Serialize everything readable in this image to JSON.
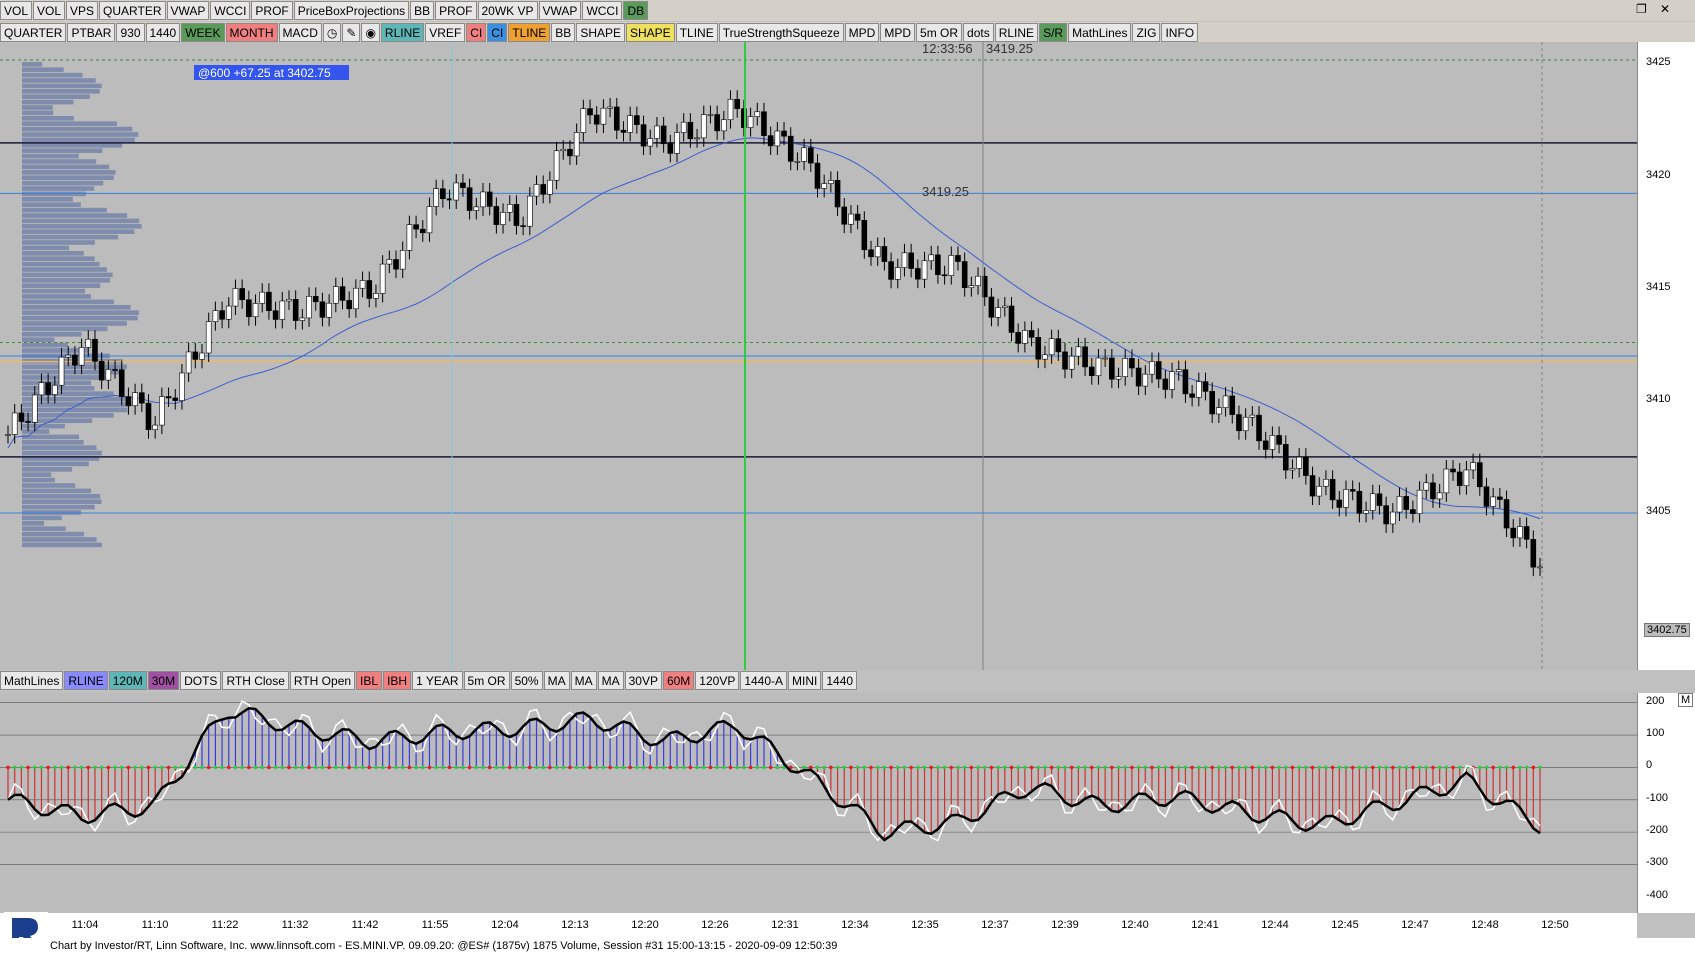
{
  "toolbar_top": [
    {
      "label": "VOL",
      "bg": "#e8e8e8"
    },
    {
      "label": "VOL",
      "bg": "#e8e8e8"
    },
    {
      "label": "VPS",
      "bg": "#e8e8e8"
    },
    {
      "label": "QUARTER",
      "bg": "#e8e8e8"
    },
    {
      "label": "VWAP",
      "bg": "#e8e8e8"
    },
    {
      "label": "WCCI",
      "bg": "#e8e8e8"
    },
    {
      "label": "PROF",
      "bg": "#e8e8e8"
    },
    {
      "label": "PriceBoxProjections",
      "bg": "#e8e8e8"
    },
    {
      "label": "BB",
      "bg": "#e8e8e8"
    },
    {
      "label": "PROF",
      "bg": "#e8e8e8"
    },
    {
      "label": "20WK VP",
      "bg": "#e8e8e8"
    },
    {
      "label": "VWAP",
      "bg": "#e8e8e8"
    },
    {
      "label": "WCCI",
      "bg": "#e8e8e8"
    },
    {
      "label": "DB",
      "bg": "#5a9a5a"
    }
  ],
  "toolbar_second": [
    {
      "label": "QUARTER",
      "bg": "#e8e8e8"
    },
    {
      "label": "PTBAR",
      "bg": "#e8e8e8"
    },
    {
      "label": "930",
      "bg": "#e8e8e8"
    },
    {
      "label": "1440",
      "bg": "#e8e8e8"
    },
    {
      "label": "WEEK",
      "bg": "#5a9a5a"
    },
    {
      "label": "MONTH",
      "bg": "#f08080"
    },
    {
      "label": "MACD",
      "bg": "#e8e8e8"
    },
    {
      "label": "",
      "icon": "clock-icon",
      "bg": "#e8e8e8"
    },
    {
      "label": "",
      "icon": "pencil-icon",
      "bg": "#e8e8e8"
    },
    {
      "label": "",
      "icon": "drop-icon",
      "bg": "#e8e8e8"
    },
    {
      "label": "RLINE",
      "bg": "#5fb6b6"
    },
    {
      "label": "VREF",
      "bg": "#e8e8e8"
    },
    {
      "label": "CI",
      "bg": "#f08080"
    },
    {
      "label": "CI",
      "bg": "#3a8fe0"
    },
    {
      "label": "TLINE",
      "bg": "#f0a030"
    },
    {
      "label": "BB",
      "bg": "#e8e8e8"
    },
    {
      "label": "SHAPE",
      "bg": "#e8e8e8"
    },
    {
      "label": "SHAPE",
      "bg": "#f0e060"
    },
    {
      "label": "TLINE",
      "bg": "#e8e8e8"
    },
    {
      "label": "TrueStrengthSqueeze",
      "bg": "#e8e8e8"
    },
    {
      "label": "MPD",
      "bg": "#e8e8e8"
    },
    {
      "label": "MPD",
      "bg": "#e8e8e8"
    },
    {
      "label": "5m OR",
      "bg": "#e8e8e8"
    },
    {
      "label": "dots",
      "bg": "#e8e8e8"
    },
    {
      "label": "RLINE",
      "bg": "#e8e8e8"
    },
    {
      "label": "S/R",
      "bg": "#5a9a5a"
    },
    {
      "label": "MathLines",
      "bg": "#e8e8e8"
    },
    {
      "label": "ZIG",
      "bg": "#e8e8e8"
    },
    {
      "label": "INFO",
      "bg": "#e8e8e8"
    }
  ],
  "toolbar_bottom": [
    {
      "label": "MathLines",
      "bg": "#e8e8e8"
    },
    {
      "label": "RLINE",
      "bg": "#8a8aff"
    },
    {
      "label": "120M",
      "bg": "#5fb6b6"
    },
    {
      "label": "30M",
      "bg": "#a050a0"
    },
    {
      "label": "DOTS",
      "bg": "#e8e8e8"
    },
    {
      "label": "RTH Close",
      "bg": "#e8e8e8"
    },
    {
      "label": "RTH Open",
      "bg": "#e8e8e8"
    },
    {
      "label": "IBL",
      "bg": "#f08080"
    },
    {
      "label": "IBH",
      "bg": "#f08080"
    },
    {
      "label": "1 YEAR",
      "bg": "#e8e8e8"
    },
    {
      "label": "5m OR",
      "bg": "#e8e8e8"
    },
    {
      "label": "50%",
      "bg": "#e8e8e8"
    },
    {
      "label": "MA",
      "bg": "#e8e8e8"
    },
    {
      "label": "MA",
      "bg": "#e8e8e8"
    },
    {
      "label": "MA",
      "bg": "#e8e8e8"
    },
    {
      "label": "30VP",
      "bg": "#e8e8e8"
    },
    {
      "label": "60M",
      "bg": "#f08080"
    },
    {
      "label": "120VP",
      "bg": "#e8e8e8"
    },
    {
      "label": "1440-A",
      "bg": "#e8e8e8"
    },
    {
      "label": "MINI",
      "bg": "#e8e8e8"
    },
    {
      "label": "1440",
      "bg": "#e8e8e8"
    }
  ],
  "annotations": {
    "bar_info": "@600  +67.25 at 3402.75",
    "cursor_time": "12:33:56",
    "cursor_price": "3419.25",
    "level_label": "3419.25",
    "last_price": "3402.75"
  },
  "price_axis": [
    "3425",
    "3420",
    "3415",
    "3410",
    "3405"
  ],
  "indicator_axis": [
    "200",
    "100",
    "0",
    "-100",
    "-200",
    "-300",
    "-400"
  ],
  "time_axis": [
    "11:04",
    "11:10",
    "11:22",
    "11:32",
    "11:42",
    "11:55",
    "12:04",
    "12:13",
    "12:20",
    "12:26",
    "12:31",
    "12:34",
    "12:35",
    "12:37",
    "12:39",
    "12:40",
    "12:41",
    "12:44",
    "12:45",
    "12:47",
    "12:48",
    "12:50"
  ],
  "footer": "Chart by Investor/RT, Linn Software, Inc. www.linnsoft.com - ES.MINI.VP.  09.09.20: @ES# (1875v) 1875 Volume, Session #31 15:00-13:15 - 2020-09-09 12:50:39",
  "pane_marker": "M",
  "colors": {
    "up": "#ffffff",
    "down": "#000000",
    "vwap": "#3a5fcd",
    "level": "#3a7fd9",
    "highlight": "#f4b860",
    "cursor": "#2ecc40",
    "volume_profile": "#6f7fa8"
  },
  "chart_data": {
    "type": "candlestick",
    "ylim": [
      3398,
      3426
    ],
    "x": [
      "11:04",
      "11:10",
      "11:22",
      "11:32",
      "11:42",
      "11:55",
      "12:04",
      "12:13",
      "12:20",
      "12:26",
      "12:31",
      "12:34",
      "12:35",
      "12:37",
      "12:39",
      "12:40",
      "12:41",
      "12:44",
      "12:45",
      "12:47",
      "12:48",
      "12:50"
    ],
    "close": [
      3408.5,
      3412.5,
      3409,
      3414.5,
      3414,
      3415,
      3419.5,
      3418,
      3423,
      3421.5,
      3423,
      3420.5,
      3416,
      3416,
      3412.5,
      3411.5,
      3411,
      3409,
      3406,
      3405,
      3407,
      3402.75
    ],
    "horizontal_levels": [
      3421.5,
      3419.25,
      3412,
      3411.75,
      3407.5,
      3405
    ],
    "indicator": {
      "ylim": [
        -450,
        230
      ],
      "values": [
        -100,
        -150,
        -120,
        180,
        120,
        80,
        110,
        120,
        150,
        80,
        130,
        -30,
        -200,
        -170,
        -60,
        -120,
        -90,
        -140,
        -180,
        -110,
        -40,
        -180
      ]
    }
  }
}
